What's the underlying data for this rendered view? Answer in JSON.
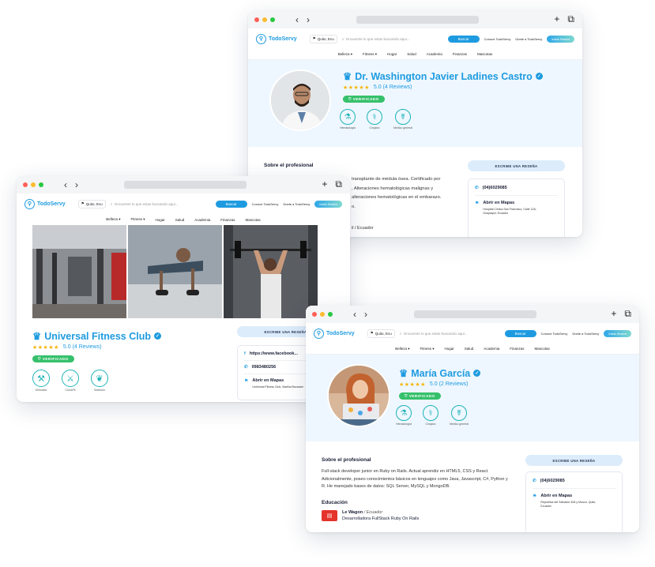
{
  "shared": {
    "logo": "TodoServy",
    "location": "Quito, Ecu",
    "search_placeholder": "Encuentre lo que estas buscando aqui...",
    "search_button": "Buscar",
    "link_know": "Conoce TodoServy",
    "link_join": "Únete a TodoServy",
    "login": "Iniciá Sesión",
    "categories": [
      "Belleza ▾",
      "Fitness ▾",
      "Hogar",
      "Salud",
      "Academia",
      "Finanzas",
      "Mascotas"
    ],
    "verified": "VERIFICADO",
    "review_button": "ESCRIBE UNA RESEÑA",
    "stars": "★★★★★",
    "map_label": "Abrir en Mapas"
  },
  "doctor": {
    "name": "Dr. Washington Javier Ladines Castro",
    "rating": "5.0 (4 Reviews)",
    "services": [
      "Hematología",
      "Cirujano",
      "Medico general"
    ],
    "about_title": "Sobre el profesional",
    "about_lines": [
      "transplante de médula ósea. Certificado por",
      ", Alteraciones hematológicas malignas y",
      "alteraciones hematológicas en el embarazo.",
      "o."
    ],
    "misc": "il / Ecuador",
    "phone": "(04)6029085",
    "address": "Hospital Clínica San Francisco, Calle 12A, Guayaquil, Ecuador"
  },
  "gym": {
    "name": "Universal Fitness Club",
    "rating": "5.0 (4 Reviews)",
    "services": [
      "Gimnasio",
      "CrossFit",
      "Nutrición"
    ],
    "facebook": "https://www.facebook...",
    "phone": "0983480256",
    "address": "Universal Fitness Club, Martha Bucaram"
  },
  "maria": {
    "name": "María García",
    "rating": "5.0 (2 Reviews)",
    "services": [
      "Hematología",
      "Cirujano",
      "Medico general"
    ],
    "about_title": "Sobre el profesional",
    "about_text": "Full-stack developer junior en Ruby on Rails. Actual aprendiz en HTML5, CSS y React. Adicionalmente, poseo conocimientos básicos en lenguajes como Java, Javascript, C#, Python y R. He manejado bases de datos: SQL Server, MySQL y MongoDB.",
    "edu_title": "Educación",
    "edu_school": "Le Wagon",
    "edu_country": "/ Ecuador",
    "edu_program": "Desarrolladora FullStack Ruby On Rails",
    "phone": "(04)6029085",
    "address": "República del Salvador 406 y Moscú, Quito, Ecuador"
  },
  "colors": {
    "accent": "#1e9be0",
    "verified": "#36c06b",
    "hero": "#eef7ff",
    "teal": "#1fb3b8"
  }
}
